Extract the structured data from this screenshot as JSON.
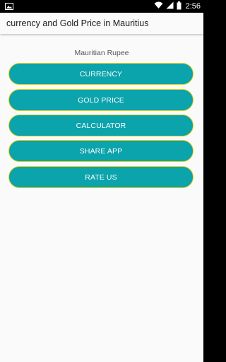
{
  "status_bar": {
    "time": "2:56",
    "icons": [
      "image-icon",
      "wifi-icon",
      "signal-icon",
      "battery-icon"
    ]
  },
  "app_bar": {
    "title": "currency and Gold Price in Mauritius"
  },
  "main": {
    "subtitle": "Mauritian Rupee",
    "buttons": [
      {
        "label": "CURRENCY"
      },
      {
        "label": "GOLD PRICE"
      },
      {
        "label": "CALCULATOR"
      },
      {
        "label": "SHARE APP"
      },
      {
        "label": "RATE US"
      }
    ]
  },
  "colors": {
    "button_fill": "#0ba3ac",
    "button_border": "#e8d21a",
    "background": "#fafafa",
    "status_bar": "#000000"
  }
}
